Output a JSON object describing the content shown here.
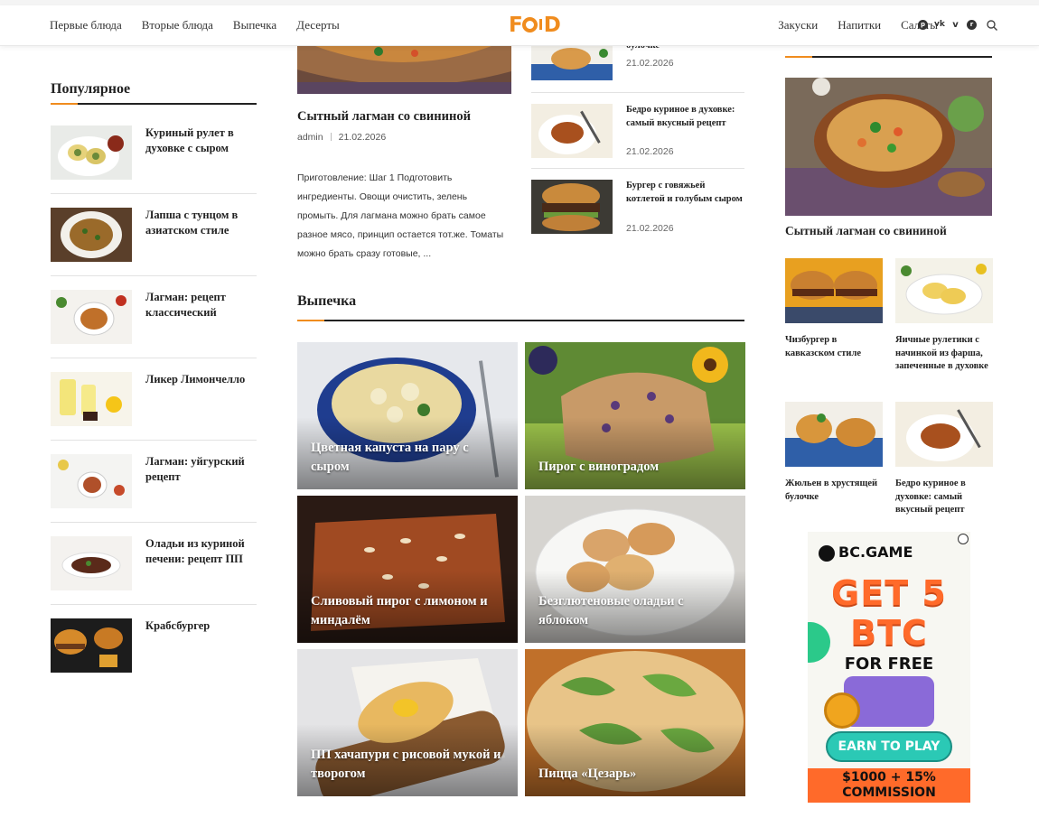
{
  "header": {
    "nav_left": [
      "Первые блюда",
      "Вторые блюда",
      "Выпечка",
      "Десерты"
    ],
    "nav_right": [
      "Закуски",
      "Напитки",
      "Салаты"
    ],
    "logo": "FOOD",
    "socials": [
      "pinterest-icon",
      "vk-icon",
      "vimeo-icon",
      "reddit-icon"
    ],
    "accent": "#f08c1e"
  },
  "popular": {
    "title": "Популярное",
    "items": [
      "Куриный рулет в духовке с сыром",
      "Лапша с тунцом в азиатском стиле",
      "Лагман: рецепт классический",
      "Ликер Лимончелло",
      "Лагман: уйгурский рецепт",
      "Оладьи из куриной печени: рецепт ПП",
      "Крабсбургер"
    ]
  },
  "featured": {
    "title": "Сытный лагман со свининой",
    "author": "admin",
    "date": "21.02.2026",
    "excerpt": "Приготовление: Шаг 1 Подготовить ингредиенты. Овощи очистить, зелень промыть. Для лагмана можно брать самое разное мясо, принцип остается тот.же. Томаты можно брать сразу готовые, ..."
  },
  "side_list": [
    {
      "title": "булочке",
      "date": "21.02.2026"
    },
    {
      "title": "Бедро куриное в духовке: самый вкусный рецепт",
      "date": "21.02.2026"
    },
    {
      "title": "Бургер с говяжьей котлетой и голубым сыром",
      "date": "21.02.2026"
    }
  ],
  "baking": {
    "title": "Выпечка",
    "tiles": [
      "Цветная капуста на пару с сыром",
      "Пирог с виноградом",
      "Сливовый пирог с лимоном и миндалём",
      "Безглютеновые оладьи с яблоком",
      "ПП хачапури с рисовой мукой и творогом",
      "Пицца «Цезарь»"
    ]
  },
  "right": {
    "featured_title": "Сытный лагман со свининой",
    "grid": [
      "Чизбургер в кавказском стиле",
      "Яичные рулетики с начинкой из фарша, запеченные в духовке",
      "Жюльен в хрустящей булочке",
      "Бедро куриное в духовке: самый вкусный рецепт"
    ]
  },
  "ad": {
    "brand": "BC.GAME",
    "line1": "GET 5",
    "line2": "BTC",
    "line3": "FOR FREE",
    "cta": "EARN TO PLAY",
    "bottom1": "$1000 + 15%",
    "bottom2": "COMMISSION"
  }
}
